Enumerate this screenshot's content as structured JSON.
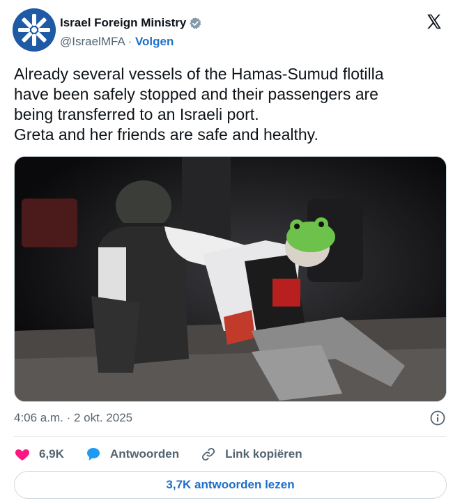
{
  "account": {
    "name": "Israel Foreign Ministry",
    "handle": "@IsraelMFA",
    "separator": " · ",
    "follow_label": "Volgen",
    "verified": true,
    "verified_color": "#829aab"
  },
  "tweet": {
    "text": "Already several vessels of the Hamas-Sumud flotilla\nhave been safely stopped and their passengers are\nbeing transferred to an Israeli port.\nGreta and her friends are safe and healthy.",
    "media_type": "video-still",
    "timestamp": "4:06 a.m. · 2 okt. 2025"
  },
  "actions": {
    "like_count": "6,9K",
    "reply_label": "Antwoorden",
    "copy_link_label": "Link kopiëren"
  },
  "replies_button": {
    "label": "3,7K antwoorden lezen"
  },
  "icons": {
    "avatar": "israel-mfa-logo",
    "verified": "verified-badge-icon",
    "platform": "x-logo-icon",
    "info": "info-icon",
    "like": "heart-icon",
    "reply": "speech-bubble-icon",
    "link": "link-icon"
  },
  "colors": {
    "like": "#f91880",
    "reply": "#1d9bf0",
    "link_text": "#1d6fc9",
    "muted_text": "#536471"
  }
}
